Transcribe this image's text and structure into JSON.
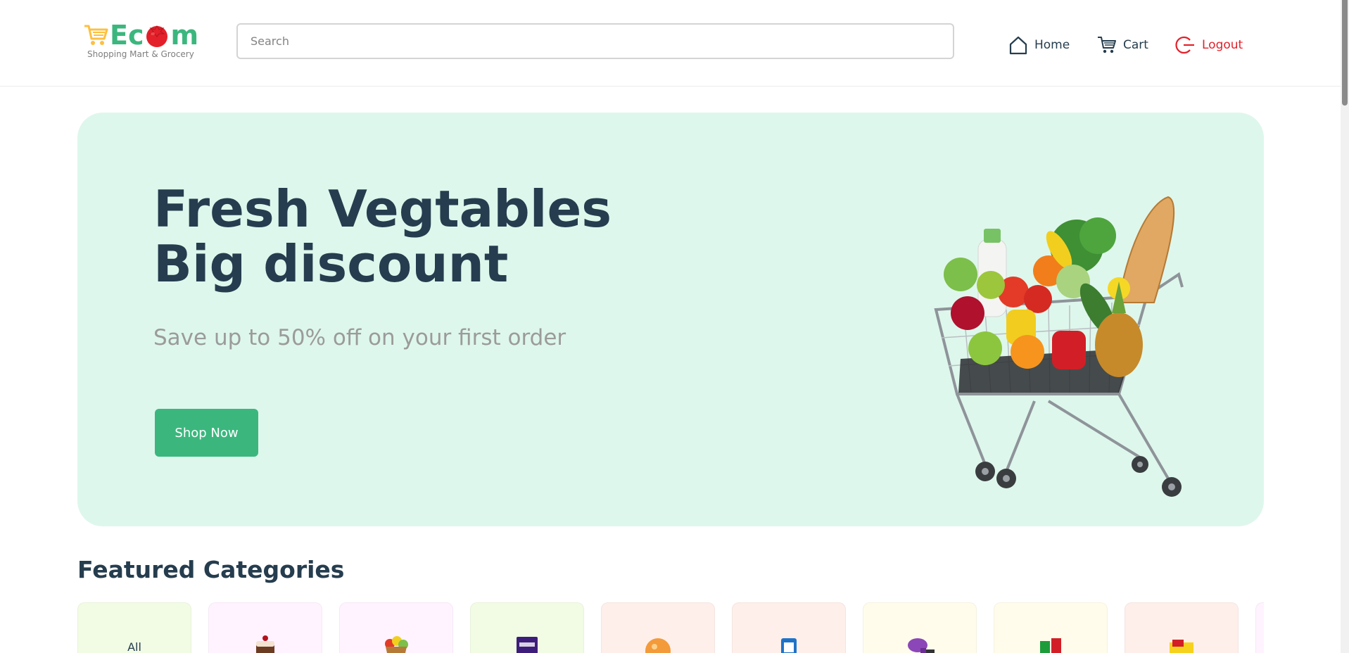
{
  "logo": {
    "wordmark": "Ecom",
    "tagline": "Shopping Mart & Grocery",
    "colors": {
      "brand_green": "#3bb77e",
      "cart_orange": "#fdc040",
      "tomato_red": "#e4202a"
    }
  },
  "search": {
    "placeholder": "Search",
    "value": ""
  },
  "nav": {
    "home": {
      "label": "Home",
      "icon": "home-icon"
    },
    "cart": {
      "label": "Cart",
      "icon": "cart-icon"
    },
    "logout": {
      "label": "Logout",
      "icon": "logout-icon",
      "color": "#e4202a"
    }
  },
  "hero": {
    "title_line1": "Fresh Vegtables",
    "title_line2": "Big discount",
    "subtitle": "Save up to 50% off on your first order",
    "cta_label": "Shop Now",
    "background": "#def7ec",
    "image": "shopping-cart-with-groceries"
  },
  "categories": {
    "heading": "Featured Categories",
    "items": [
      {
        "label": "All",
        "bg": "#f2fce4",
        "icon": "all-category"
      },
      {
        "label": "",
        "bg": "#fff3ff",
        "icon": "cake-icon"
      },
      {
        "label": "",
        "bg": "#fff3ff",
        "icon": "fruit-basket-icon"
      },
      {
        "label": "",
        "bg": "#f2fce4",
        "icon": "chocolate-icon"
      },
      {
        "label": "",
        "bg": "#feefea",
        "icon": "snack-icon"
      },
      {
        "label": "",
        "bg": "#feefea",
        "icon": "milk-icon"
      },
      {
        "label": "",
        "bg": "#fffceb",
        "icon": "hair-dryer-icon"
      },
      {
        "label": "",
        "bg": "#fffceb",
        "icon": "sauce-icon"
      },
      {
        "label": "",
        "bg": "#feefea",
        "icon": "noodles-icon"
      },
      {
        "label": "",
        "bg": "#fff3ff",
        "icon": "more-category"
      }
    ]
  }
}
